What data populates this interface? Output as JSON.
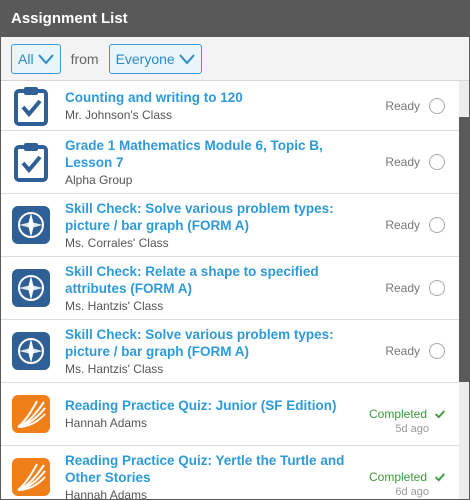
{
  "window": {
    "title": "Assignment List"
  },
  "filters": {
    "scope_value": "All",
    "from_label": "from",
    "source_value": "Everyone"
  },
  "assignments": [
    {
      "title": "Counting and writing to 120",
      "subtitle": "Mr. Johnson's Class",
      "status": "Ready",
      "icon": "clipboard-check-icon"
    },
    {
      "title": "Grade 1 Mathematics Module 6, Topic B, Lesson 7",
      "subtitle": "Alpha Group",
      "status": "Ready",
      "icon": "clipboard-check-icon"
    },
    {
      "title": "Skill Check: Solve various problem types: picture / bar graph (FORM A)",
      "subtitle": "Ms. Corrales' Class",
      "status": "Ready",
      "icon": "compass-icon"
    },
    {
      "title": "Skill Check: Relate a shape to specified attributes (FORM A)",
      "subtitle": "Ms. Hantzis' Class",
      "status": "Ready",
      "icon": "compass-icon"
    },
    {
      "title": "Skill Check: Solve various problem types: picture / bar graph (FORM A)",
      "subtitle": "Ms. Hantzis' Class",
      "status": "Ready",
      "icon": "compass-icon"
    },
    {
      "title": "Reading Practice Quiz: Junior (SF Edition)",
      "subtitle": "Hannah Adams",
      "status": "Completed",
      "ago": "5d ago",
      "icon": "book-pages-icon"
    },
    {
      "title": "Reading Practice Quiz: Yertle the Turtle and Other Stories",
      "subtitle": "Hannah Adams",
      "status": "Completed",
      "ago": "6d ago",
      "icon": "book-pages-icon"
    }
  ],
  "colors": {
    "accent": "#2e9ad8",
    "titlebar": "#595959",
    "completed": "#3a9a3a",
    "compass_bg": "#2f5f95",
    "book_bg": "#f07f1a"
  }
}
